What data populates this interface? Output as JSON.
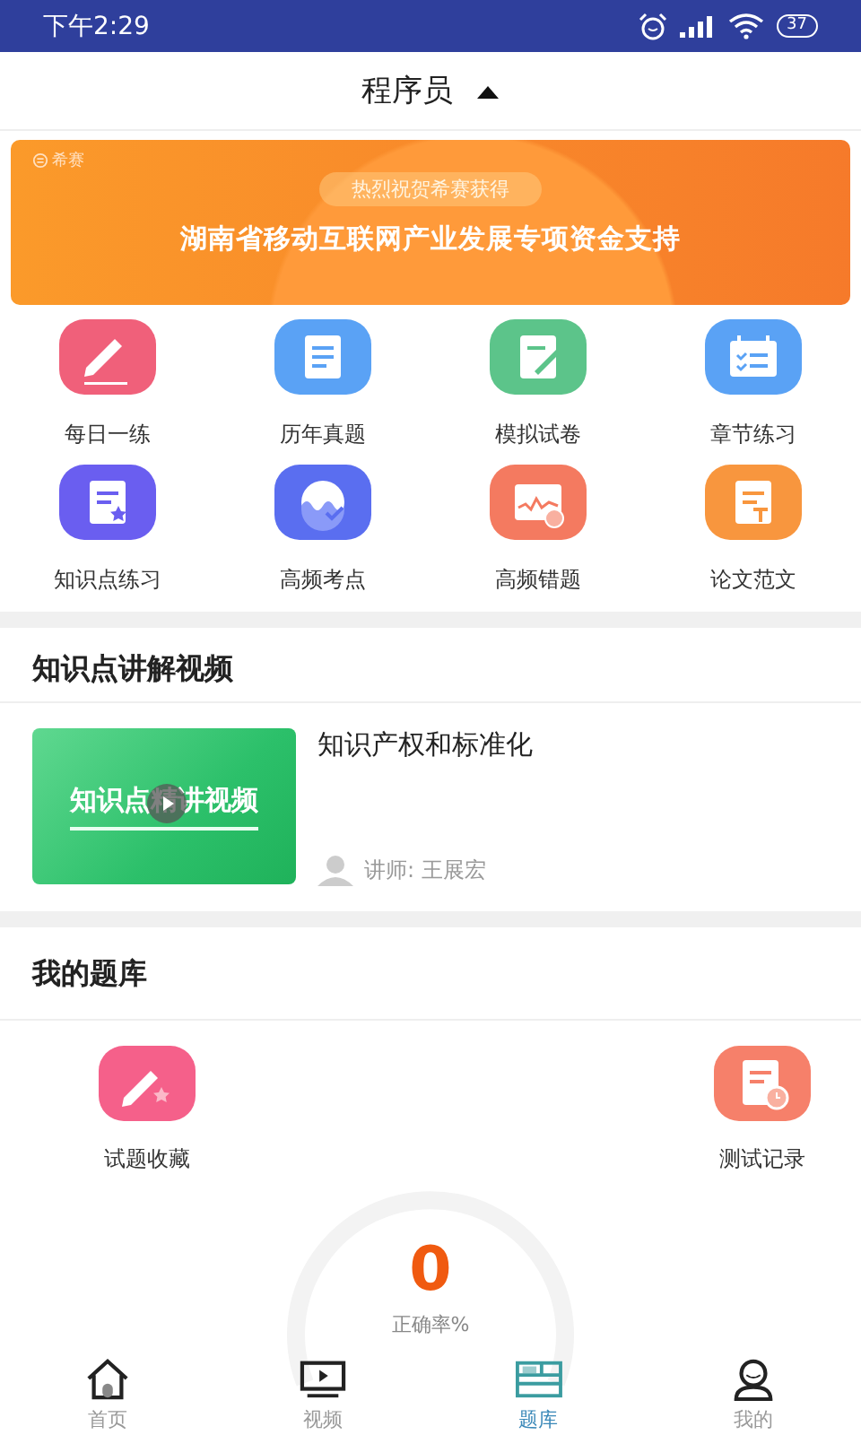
{
  "status_bar": {
    "time": "下午2:29",
    "battery": "37"
  },
  "header": {
    "title": "程序员",
    "expanded": true
  },
  "banner": {
    "logo": "希赛",
    "tagline": "热烈祝贺希赛获得",
    "headline": "湖南省移动互联网产业发展专项资金支持"
  },
  "features": [
    {
      "label": "每日一练",
      "kind": "pencil",
      "color": "#f0607a"
    },
    {
      "label": "历年真题",
      "kind": "document",
      "color": "#5aa2f5"
    },
    {
      "label": "模拟试卷",
      "kind": "edit-doc",
      "color": "#5cc48a"
    },
    {
      "label": "章节练习",
      "kind": "calendar",
      "color": "#5aa2f5"
    },
    {
      "label": "知识点练习",
      "kind": "doc-star",
      "color": "#6a5ef0"
    },
    {
      "label": "高频考点",
      "kind": "wave",
      "color": "#5a6ef0"
    },
    {
      "label": "高频错题",
      "kind": "chart",
      "color": "#f47a60"
    },
    {
      "label": "论文范文",
      "kind": "doc-t",
      "color": "#f8963e"
    }
  ],
  "video_section": {
    "title": "知识点讲解视频",
    "videos": [
      {
        "thumbnail_text": "知识点精讲视频",
        "title": "知识产权和标准化",
        "lecturer": "讲师: 王展宏"
      }
    ]
  },
  "bank_section": {
    "title": "我的题库",
    "items": [
      {
        "label": "试题收藏",
        "kind": "pencil-star",
        "color": "#f5608a"
      },
      {
        "label": "测试记录",
        "kind": "doc-clock",
        "color": "#f6806a"
      }
    ],
    "score": "0",
    "score_label": "正确率%"
  },
  "tabs": [
    {
      "label": "首页",
      "kind": "home",
      "selected": false
    },
    {
      "label": "视频",
      "kind": "tv",
      "selected": false
    },
    {
      "label": "题库",
      "kind": "book",
      "selected": true
    },
    {
      "label": "我的",
      "kind": "user",
      "selected": false
    }
  ]
}
